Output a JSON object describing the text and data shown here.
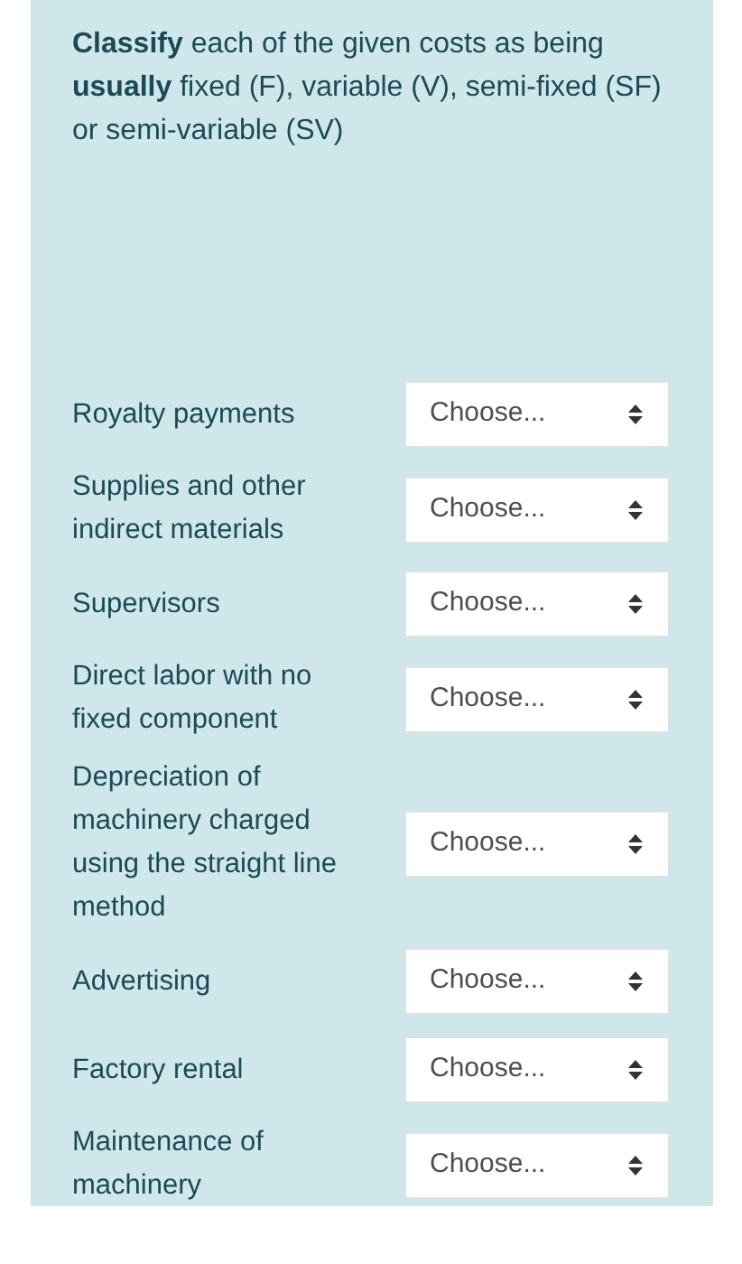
{
  "instruction": "**Classify** each of the given costs as being **usually** fixed (F), variable (V), semi-fixed (SF) or semi-variable (SV)",
  "items": [
    {
      "label": "Royalty payments",
      "select": "Choose..."
    },
    {
      "label": "Supplies and other indirect materials",
      "select": "Choose..."
    },
    {
      "label": "Supervisors",
      "select": "Choose..."
    },
    {
      "label": "Direct labor with no fixed component",
      "select": "Choose..."
    },
    {
      "label": "Depreciation of machinery charged using the straight line method",
      "select": "Choose..."
    },
    {
      "label": "Advertising",
      "select": "Choose..."
    },
    {
      "label": "Factory rental",
      "select": "Choose..."
    },
    {
      "label": "Maintenance of machinery",
      "select": "Choose..."
    }
  ]
}
